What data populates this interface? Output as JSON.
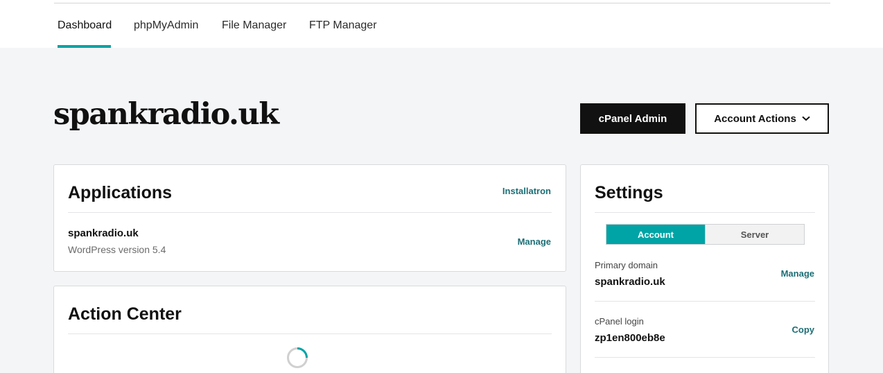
{
  "nav": {
    "tabs": [
      {
        "label": "Dashboard",
        "active": true
      },
      {
        "label": "phpMyAdmin"
      },
      {
        "label": "File Manager"
      },
      {
        "label": "FTP Manager"
      }
    ]
  },
  "header": {
    "domain": "spankradio.uk",
    "cpanel_admin_label": "cPanel Admin",
    "account_actions_label": "Account Actions"
  },
  "applications": {
    "title": "Applications",
    "installatron_label": "Installatron",
    "items": [
      {
        "name": "spankradio.uk",
        "subtitle": "WordPress version 5.4",
        "action": "Manage"
      }
    ]
  },
  "action_center": {
    "title": "Action Center"
  },
  "settings": {
    "title": "Settings",
    "segments": [
      "Account",
      "Server"
    ],
    "selected_segment": "Account",
    "rows": [
      {
        "label": "Primary domain",
        "value": "spankradio.uk",
        "action": "Manage"
      },
      {
        "label": "cPanel login",
        "value": "zp1en800eb8e",
        "action": "Copy"
      }
    ]
  },
  "colors": {
    "accent": "#00a4a6",
    "link": "#1b6e75",
    "primary_button": "#111111",
    "background": "#f4f5f7"
  },
  "icons": {
    "account_actions": "chevron-down-icon",
    "loading": "spinner-icon"
  }
}
